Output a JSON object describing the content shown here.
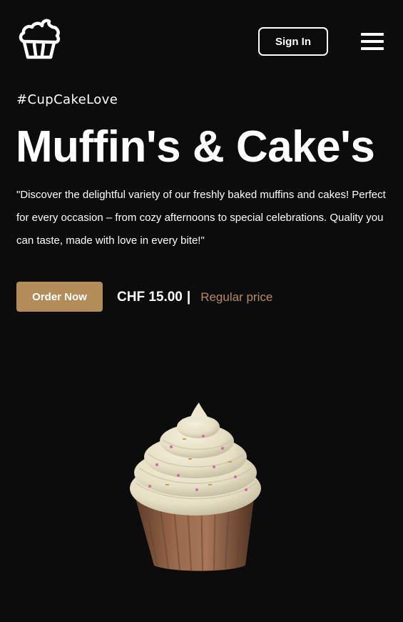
{
  "header": {
    "logo_icon": "cupcake-icon",
    "signin_label": "Sign In",
    "menu_icon": "hamburger-menu-icon"
  },
  "hero": {
    "hashtag": "#CupCakeLove",
    "title": "Muffin's & Cake's",
    "description": "\"Discover the delightful variety of our freshly baked muffins and cakes! Perfect for every occasion – from cozy afternoons to special celebrations. Quality you can taste, made with love in every bite!\"",
    "order_label": "Order Now",
    "price": "CHF 15.00",
    "separator": "|",
    "price_note": "Regular price"
  },
  "product_image": "cupcake-image",
  "colors": {
    "background": "#0c0c0d",
    "accent": "#b48c5c",
    "text": "#ffffff"
  }
}
